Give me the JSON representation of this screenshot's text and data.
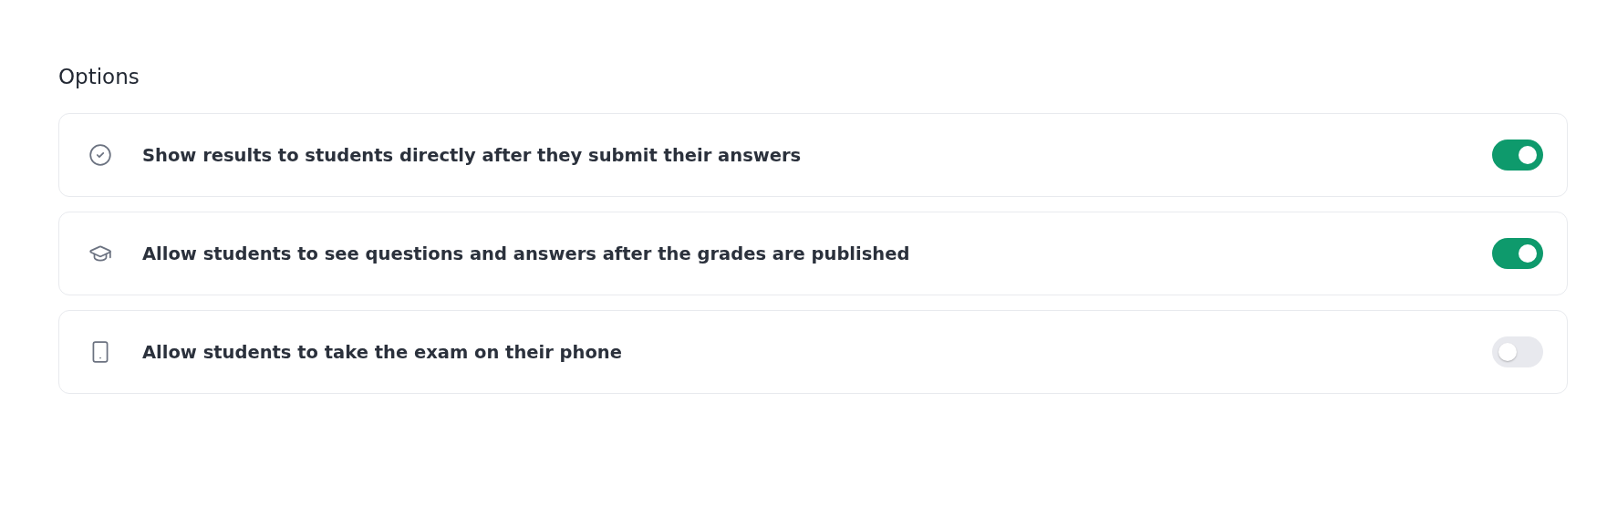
{
  "section_title": "Options",
  "options": [
    {
      "kind": "check",
      "label": "Show results to students directly after they submit their answers",
      "on": true
    },
    {
      "kind": "graduation",
      "label": "Allow students to see questions and answers after the grades are published",
      "on": true
    },
    {
      "kind": "phone",
      "label": "Allow students to take the exam on their phone",
      "on": false
    }
  ]
}
